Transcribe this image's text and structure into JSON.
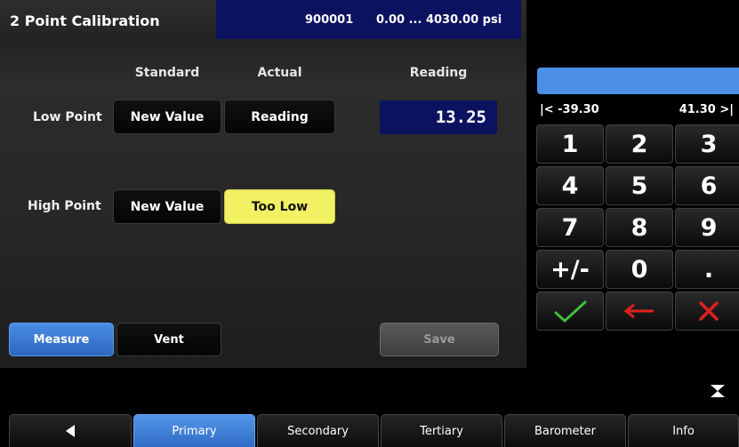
{
  "header": {
    "title": "2 Point Calibration",
    "sensor_id": "900001",
    "sensor_range": "0.00 ... 4030.00 psi"
  },
  "columns": {
    "standard": "Standard",
    "actual": "Actual",
    "reading": "Reading"
  },
  "low_point": {
    "label": "Low Point",
    "standard_button": "New Value",
    "actual_button": "Reading",
    "reading_value": "13.25"
  },
  "high_point": {
    "label": "High Point",
    "standard_button": "New Value",
    "actual_button": "Too Low"
  },
  "actions": {
    "measure": "Measure",
    "vent": "Vent",
    "save": "Save"
  },
  "keypad": {
    "input_value": "",
    "range_min": "|< -39.30",
    "range_max": "41.30 >|",
    "keys": [
      "1",
      "2",
      "3",
      "4",
      "5",
      "6",
      "7",
      "8",
      "9",
      "+/-",
      "0",
      "."
    ],
    "accept_icon": "checkmark-icon",
    "backspace_icon": "left-arrow-icon",
    "cancel_icon": "x-icon"
  },
  "tabs": {
    "back_icon": "back-triangle-icon",
    "items": [
      "Primary",
      "Secondary",
      "Tertiary",
      "Barometer",
      "Info"
    ],
    "active": "Primary"
  },
  "colors": {
    "highlight_yellow": "#f2f063",
    "accent_blue": "#4b8ee6",
    "display_navy": "#0b1260",
    "accept_green": "#3fbf3f",
    "cancel_red": "#e02020"
  }
}
